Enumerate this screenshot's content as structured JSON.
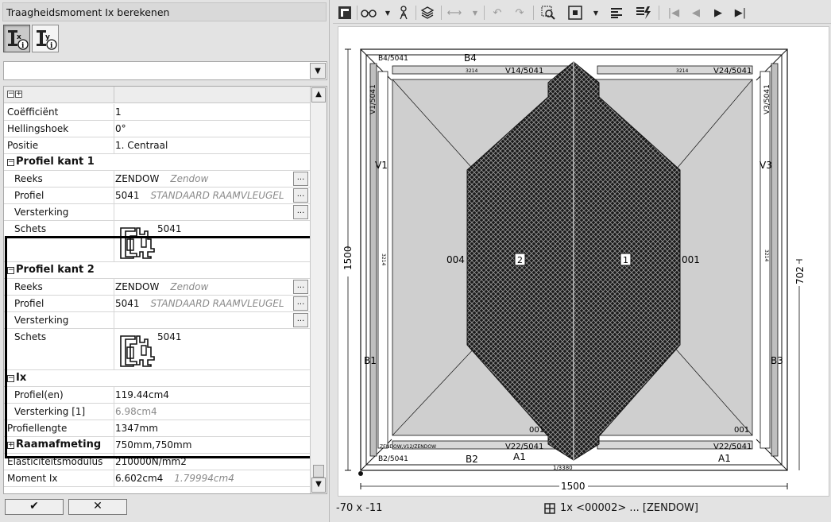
{
  "window": {
    "title": "Traagheidsmoment Ix berekenen"
  },
  "property_tools": [
    {
      "name": "ix-icon",
      "label": "Ix"
    },
    {
      "name": "iy-icon",
      "label": "Iy"
    }
  ],
  "grid": {
    "rows": [
      {
        "name": "Coëfficiënt",
        "value": "1"
      },
      {
        "name": "Hellingshoek",
        "value": "0°"
      },
      {
        "name": "Positie",
        "value": "1. Centraal"
      }
    ],
    "group1": {
      "title": "Profiel kant 1",
      "reeks_label": "Reeks",
      "reeks_value": "ZENDOW",
      "reeks_sub": "Zendow",
      "profiel_label": "Profiel",
      "profiel_value": "5041",
      "profiel_sub": "STANDAARD RAAMVLEUGEL",
      "versterking_label": "Versterking",
      "schets_label": "Schets",
      "schets_value": "5041"
    },
    "group2": {
      "title": "Profiel kant 2",
      "reeks_label": "Reeks",
      "reeks_value": "ZENDOW",
      "reeks_sub": "Zendow",
      "profiel_label": "Profiel",
      "profiel_value": "5041",
      "profiel_sub": "STANDAARD RAAMVLEUGEL",
      "versterking_label": "Versterking",
      "schets_label": "Schets",
      "schets_value": "5041"
    },
    "ix": {
      "title": "Ix",
      "profielen_label": "Profiel(en)",
      "profielen_value": "119.44cm4",
      "versterking_label": "Versterking [1]",
      "versterking_value": "6.98cm4"
    },
    "tail": [
      {
        "name": "Profiellengte",
        "value": "1347mm"
      }
    ],
    "raamafmeting": {
      "label": "Raamafmeting",
      "value": "750mm,750mm"
    },
    "elasticiteit": {
      "label": "Elasticiteitsmodulus",
      "value": "210000N/mm2"
    },
    "moment": {
      "label": "Moment Ix",
      "value": "6.602cm4",
      "sub": "1.79994cm4"
    },
    "ellipsis": "..."
  },
  "buttons": {
    "ok": "✔",
    "cancel": "✕"
  },
  "drawing": {
    "dim_width": "1500",
    "dim_height": "1500",
    "dim_right": "702",
    "labels": {
      "b4": "B4/5041",
      "b4b": "B4",
      "v14": "V14/5041",
      "v24": "V24/5041",
      "v1": "V1/5041",
      "v1b": "V1",
      "v3": "V3/5041",
      "v3b": "V3",
      "b1": "B1",
      "b3": "B3",
      "b2": "B2/5041",
      "b2b": "B2",
      "a1": "A1",
      "a1b": "A1",
      "v22": "V22/5041",
      "v22b": "V22/5041",
      "v12": "ZENDOW,V12/ZENDOW",
      "n004": "004",
      "n001": "001",
      "n001b": "001",
      "n001c": "001",
      "num1": "1",
      "num2": "2",
      "small": "3214",
      "bottom_small": "1/3380",
      "side_small": "3214"
    }
  },
  "status": {
    "coords": "-70 x -11",
    "info": "1x <00002> ... [ZENDOW]"
  }
}
